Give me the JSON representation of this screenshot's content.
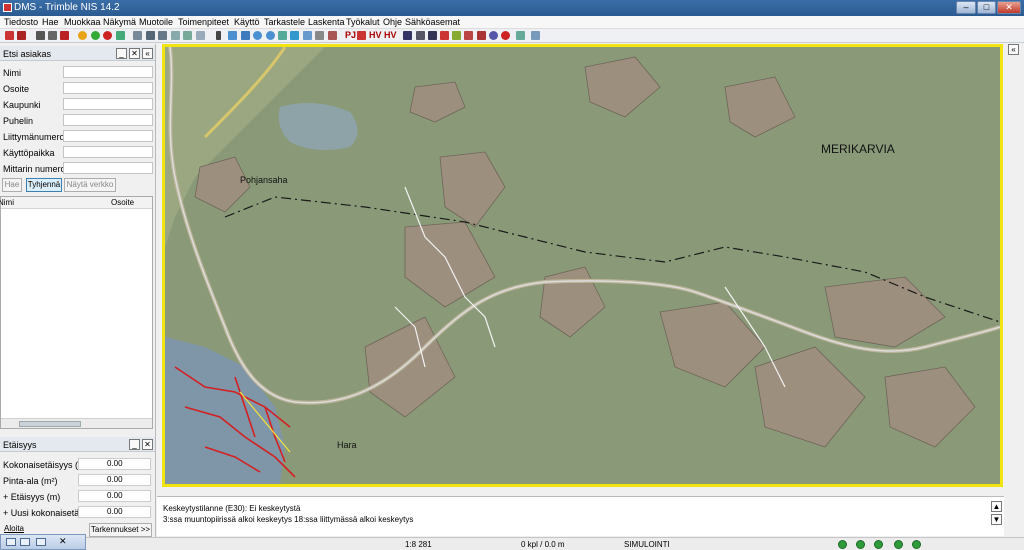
{
  "window": {
    "title": "DMS - Trimble NIS 14.2"
  },
  "menu": [
    "Tiedosto",
    "Hae",
    "Muokkaa",
    "Näkymä",
    "Muotoile",
    "Toimenpiteet",
    "Käyttö",
    "Tarkastele",
    "Laskenta",
    "Työkalut",
    "Ohje",
    "Sähköasemat"
  ],
  "toolbar": {
    "text_buttons": [
      "PJ",
      "HV",
      "HV"
    ]
  },
  "search_panel": {
    "title": "Etsi asiakas",
    "fields": [
      {
        "label": "Nimi",
        "value": ""
      },
      {
        "label": "Osoite",
        "value": ""
      },
      {
        "label": "Kaupunki",
        "value": ""
      },
      {
        "label": "Puhelin",
        "value": ""
      },
      {
        "label": "Liittymänumero",
        "value": ""
      },
      {
        "label": "Käyttöpaikka",
        "value": ""
      },
      {
        "label": "Mittarin numero",
        "value": ""
      }
    ],
    "buttons": [
      "Hae",
      "Tyhjennä",
      "Näytä verkko"
    ],
    "columns": [
      "Nimi",
      "Osoite"
    ]
  },
  "distance_panel": {
    "title": "Etäisyys",
    "rows": [
      {
        "label": "Kokonaisetäisyys (m)",
        "value": "0.00"
      },
      {
        "label": "Pinta-ala (m²)",
        "value": "0.00"
      },
      {
        "label": "+ Etäisyys (m)",
        "value": "0.00"
      },
      {
        "label": "+ Uusi kokonaisetäisyys (m)",
        "value": "0.00"
      }
    ],
    "start_button": "Aloita",
    "options_button": "Tarkennukset >>"
  },
  "map": {
    "labels": {
      "place1": "MERIKARVIA",
      "place2": "Pohjansaha",
      "place3": "Hara"
    },
    "frame_color": "#f2e411"
  },
  "messages": [
    "Keskeytystilanne (E30): Ei keskeytystä",
    "3:ssa muuntopiirissä alkoi keskeytys 18:ssa liittymässä alkoi keskeytys"
  ],
  "status": {
    "scale": "1:8 281",
    "count": "0 kpl / 0.0 m",
    "mode": "SIMULOINTI"
  }
}
